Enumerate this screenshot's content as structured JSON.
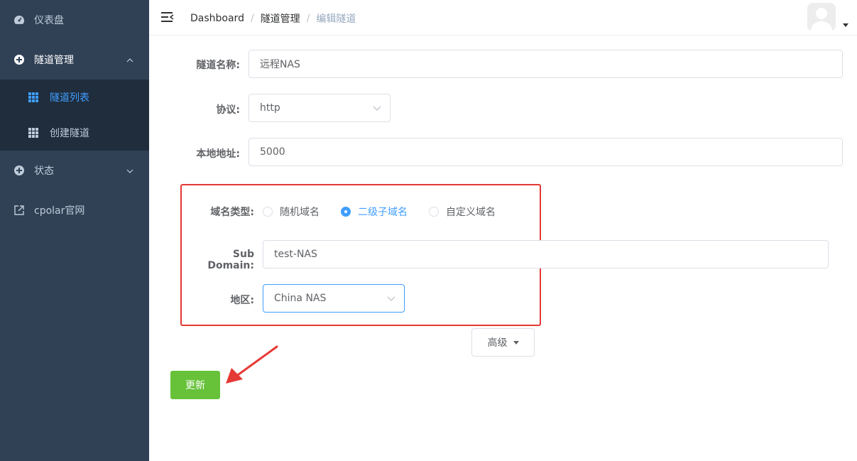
{
  "sidebar": {
    "items": [
      {
        "label": "仪表盘",
        "icon": "dashboard-icon"
      },
      {
        "label": "隧道管理",
        "icon": "tunnel-manage-icon"
      },
      {
        "label": "状态",
        "icon": "status-icon"
      },
      {
        "label": "cpolar官网",
        "icon": "external-link-icon"
      }
    ],
    "submenu": [
      {
        "label": "隧道列表",
        "icon": "grid-icon",
        "active": true
      },
      {
        "label": "创建隧道",
        "icon": "grid-icon",
        "active": false
      }
    ]
  },
  "header": {
    "breadcrumb": [
      "Dashboard",
      "隧道管理",
      "编辑隧道"
    ]
  },
  "form": {
    "tunnel_name": {
      "label": "隧道名称:",
      "value": "远程NAS"
    },
    "protocol": {
      "label": "协议:",
      "value": "http"
    },
    "local_address": {
      "label": "本地地址:",
      "value": "5000"
    },
    "domain_type": {
      "label": "域名类型:",
      "options": [
        "随机域名",
        "二级子域名",
        "自定义域名"
      ],
      "selected": "二级子域名"
    },
    "sub_domain": {
      "label": "Sub Domain:",
      "value": "test-NAS"
    },
    "region": {
      "label": "地区:",
      "value": "China NAS"
    },
    "advanced_label": "高级",
    "update_label": "更新"
  },
  "colors": {
    "sidebar_bg": "#304156",
    "submenu_bg": "#1f2d3d",
    "accent": "#409eff",
    "primary_green": "#67c23a",
    "annotation_red": "#e53935"
  }
}
